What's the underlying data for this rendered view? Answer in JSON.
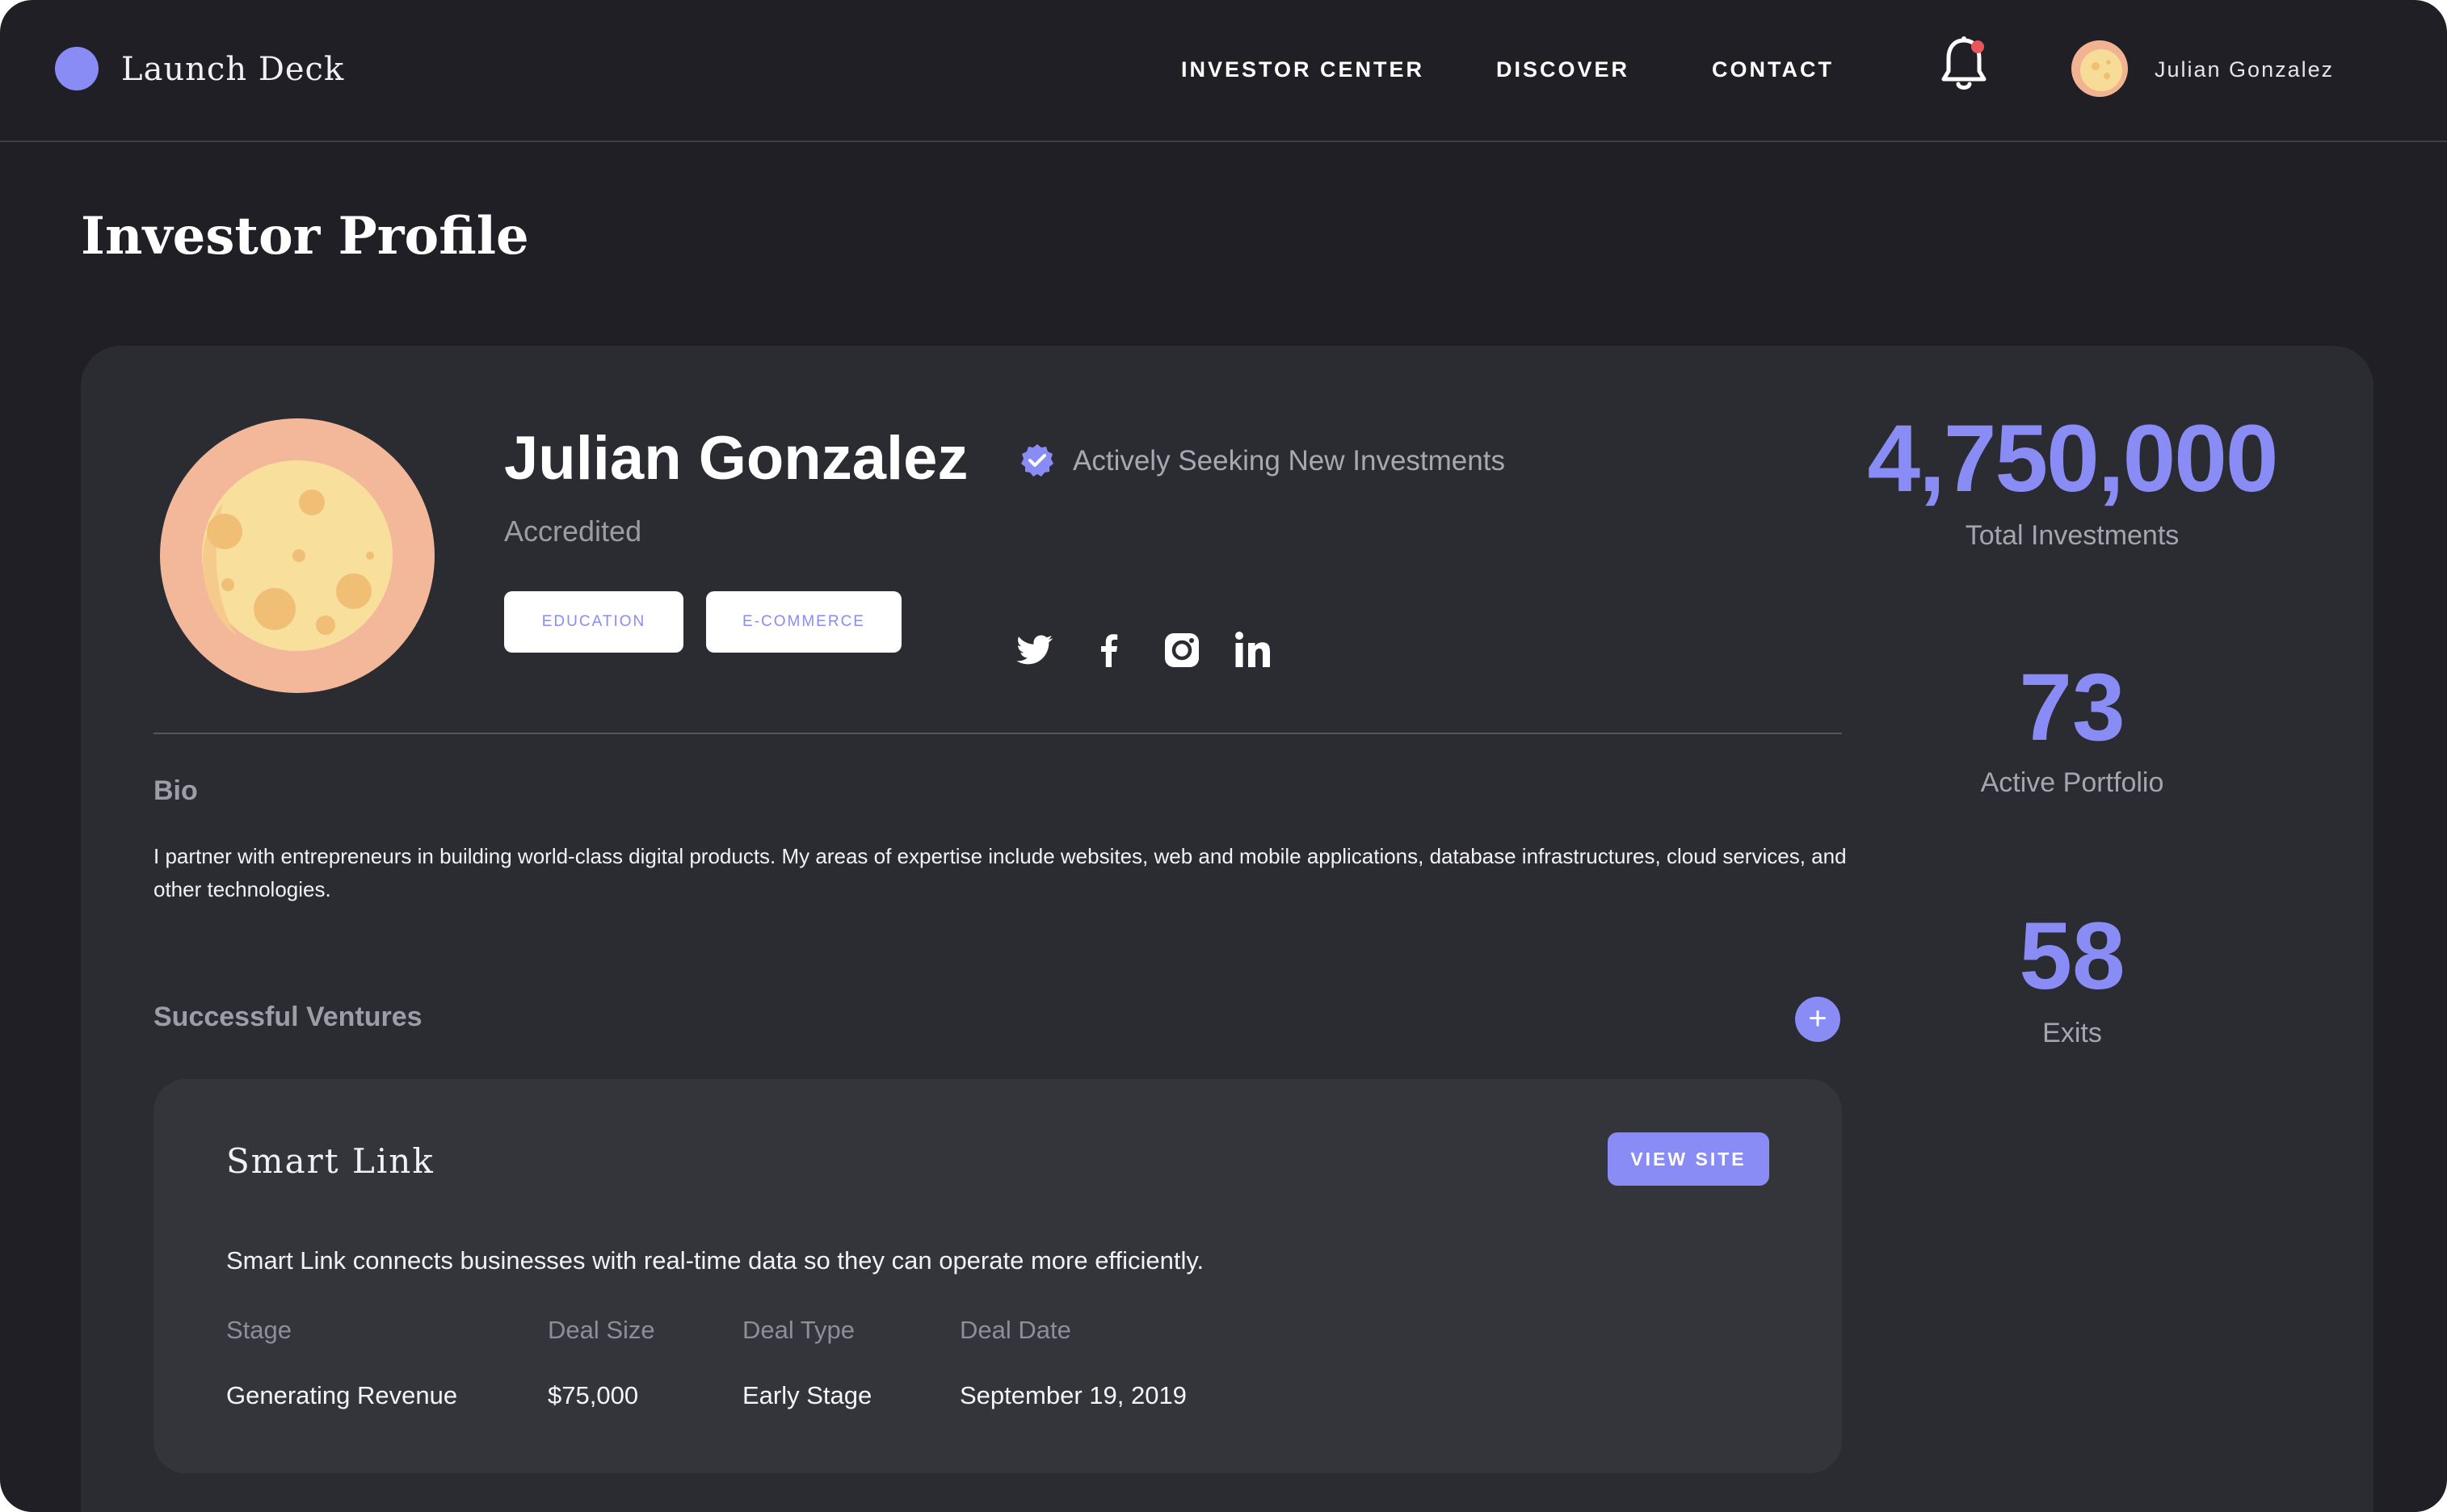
{
  "app": {
    "name": "Launch Deck",
    "accent_color": "#8a8cf5",
    "background_color": "#1f1f25"
  },
  "nav": {
    "items": [
      {
        "label": "INVESTOR CENTER"
      },
      {
        "label": "DISCOVER"
      },
      {
        "label": "CONTACT"
      }
    ],
    "notification_icon": "bell-icon",
    "notification_dot_color": "#e8555a",
    "user_name": "Julian Gonzalez"
  },
  "page": {
    "title": "Investor Profile"
  },
  "profile": {
    "name": "Julian Gonzalez",
    "status": "Accredited",
    "seeking_label": "Actively Seeking New Investments",
    "seeking_icon": "verified-check-icon",
    "tags": [
      {
        "label": "EDUCATION"
      },
      {
        "label": "E-COMMERCE"
      }
    ],
    "social_icons": [
      "twitter-icon",
      "facebook-icon",
      "instagram-icon",
      "linkedin-icon"
    ]
  },
  "bio": {
    "heading": "Bio",
    "text": "I partner with entrepreneurs in building world-class digital products. My areas of expertise include websites, web and mobile applications, database infrastructures, cloud services, and other technologies."
  },
  "ventures": {
    "heading": "Successful Ventures",
    "add_label": "+",
    "items": [
      {
        "name": "Smart Link",
        "button_label": "VIEW SITE",
        "description": "Smart Link connects businesses with real-time data so they can operate more efficiently.",
        "fields": [
          {
            "label": "Stage",
            "value": "Generating Revenue"
          },
          {
            "label": "Deal Size",
            "value": "$75,000"
          },
          {
            "label": "Deal Type",
            "value": "Early Stage"
          },
          {
            "label": "Deal Date",
            "value": "September 19, 2019"
          }
        ]
      }
    ]
  },
  "stats": [
    {
      "value": "4,750,000",
      "label": "Total Investments"
    },
    {
      "value": "73",
      "label": "Active Portfolio"
    },
    {
      "value": "58",
      "label": "Exits"
    }
  ]
}
